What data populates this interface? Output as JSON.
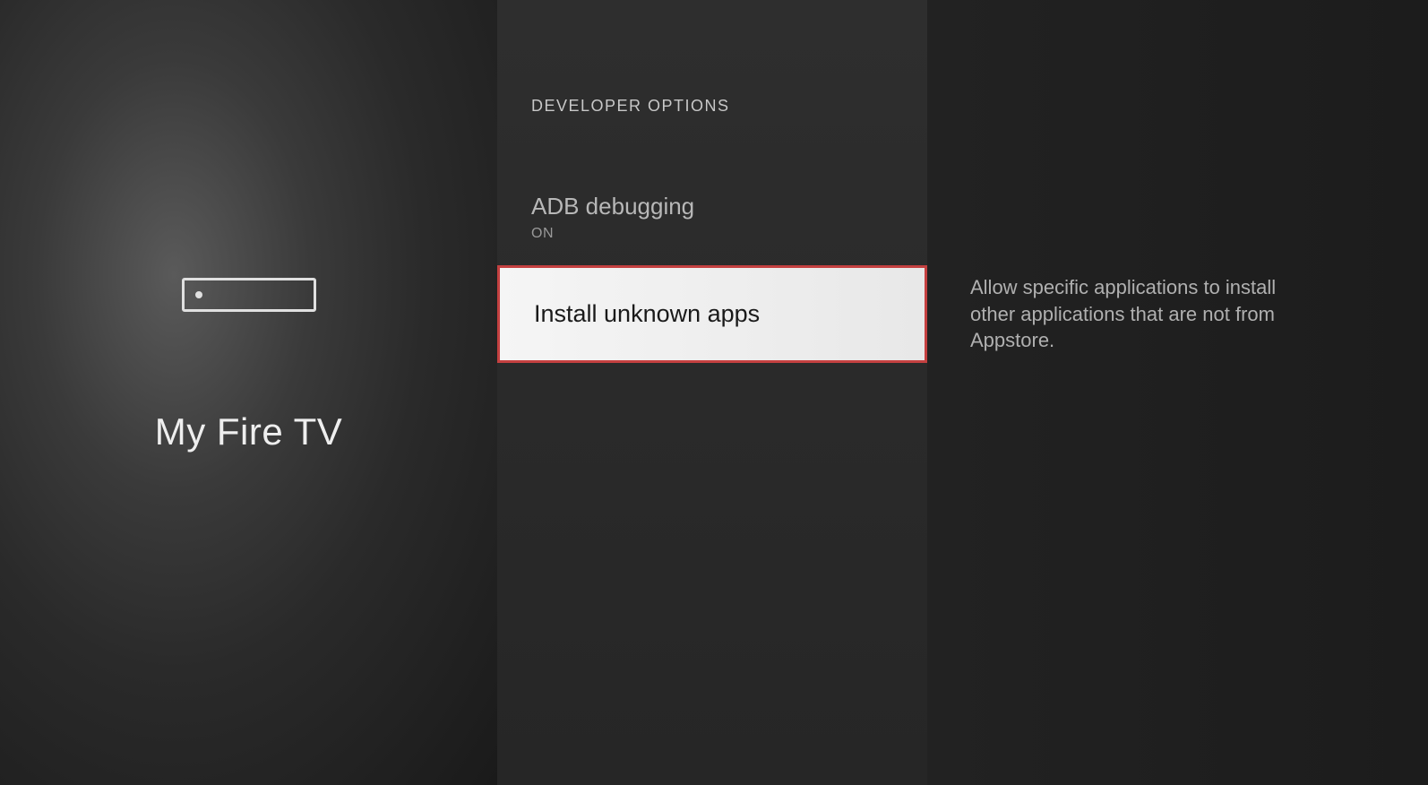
{
  "leftPanel": {
    "title": "My Fire TV"
  },
  "middlePanel": {
    "header": "DEVELOPER OPTIONS",
    "items": [
      {
        "title": "ADB debugging",
        "status": "ON",
        "selected": false
      },
      {
        "title": "Install unknown apps",
        "status": "",
        "selected": true
      }
    ]
  },
  "rightPanel": {
    "description": "Allow specific applications to install other applications that are not from Appstore."
  }
}
